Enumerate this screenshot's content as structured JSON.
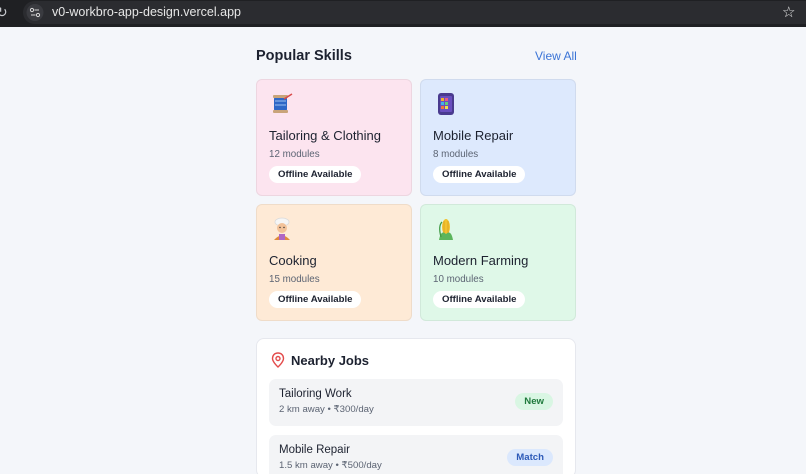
{
  "browser": {
    "url": "v0-workbro-app-design.vercel.app"
  },
  "popular_skills": {
    "title": "Popular Skills",
    "view_all": "View All",
    "cards": [
      {
        "icon": "sewing-thread-icon",
        "title": "Tailoring & Clothing",
        "modules": "12 modules",
        "badge": "Offline Available",
        "color": "#fce4ef"
      },
      {
        "icon": "mobile-phone-icon",
        "title": "Mobile Repair",
        "modules": "8 modules",
        "badge": "Offline Available",
        "color": "#dde9fd"
      },
      {
        "icon": "chef-icon",
        "title": "Cooking",
        "modules": "15 modules",
        "badge": "Offline Available",
        "color": "#feead6"
      },
      {
        "icon": "corn-icon",
        "title": "Modern Farming",
        "modules": "10 modules",
        "badge": "Offline Available",
        "color": "#dff8e8"
      }
    ]
  },
  "nearby_jobs": {
    "title": "Nearby Jobs",
    "items": [
      {
        "title": "Tailoring Work",
        "meta": "2 km away • ₹300/day",
        "tag": "New"
      },
      {
        "title": "Mobile Repair",
        "meta": "1.5 km away • ₹500/day",
        "tag": "Match"
      }
    ]
  }
}
